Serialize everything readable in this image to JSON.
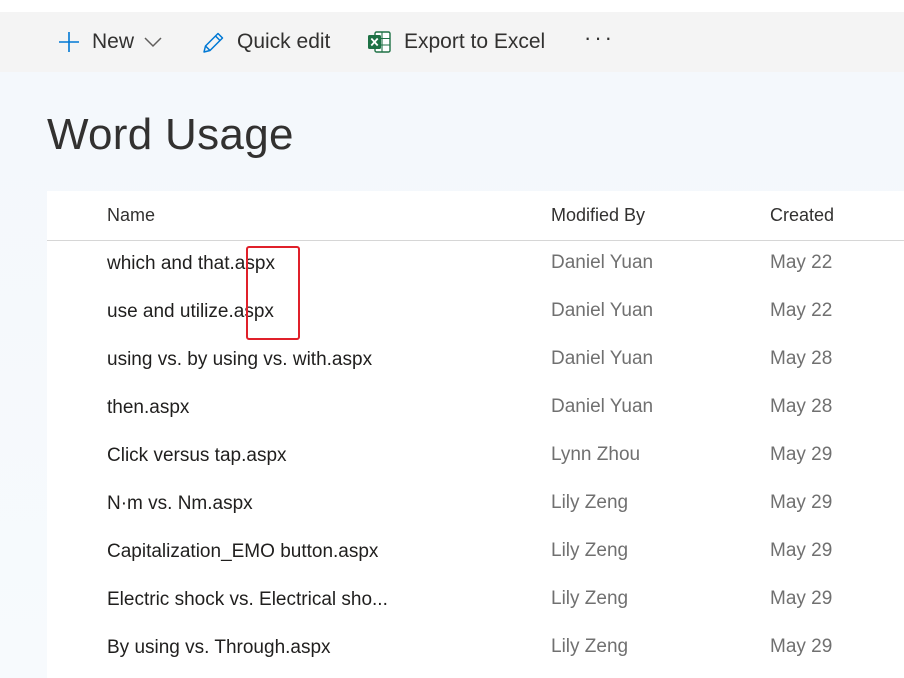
{
  "commandbar": {
    "new_label": "New",
    "quick_edit_label": "Quick edit",
    "export_label": "Export to Excel",
    "more_label": "···"
  },
  "page": {
    "title": "Word Usage"
  },
  "list": {
    "columns": {
      "name": "Name",
      "modified_by": "Modified By",
      "created": "Created"
    },
    "rows": [
      {
        "name": "which and that.aspx",
        "modified_by": "Daniel Yuan",
        "created": "May 22"
      },
      {
        "name": "use and utilize.aspx",
        "modified_by": "Daniel Yuan",
        "created": "May 22"
      },
      {
        "name": "using vs. by using vs. with.aspx",
        "modified_by": "Daniel Yuan",
        "created": "May 28"
      },
      {
        "name": "then.aspx",
        "modified_by": "Daniel Yuan",
        "created": "May 28"
      },
      {
        "name": "Click versus tap.aspx",
        "modified_by": "Lynn Zhou",
        "created": "May 29"
      },
      {
        "name": "N·m vs. Nm.aspx",
        "modified_by": "Lily Zeng",
        "created": "May 29"
      },
      {
        "name": "Capitalization_EMO button.aspx",
        "modified_by": "Lily Zeng",
        "created": "May 29"
      },
      {
        "name": "Electric shock vs. Electrical sho...",
        "modified_by": "Lily Zeng",
        "created": "May 29"
      },
      {
        "name": "By using vs. Through.aspx",
        "modified_by": "Lily Zeng",
        "created": "May 29"
      }
    ]
  },
  "colors": {
    "accent": "#0078d4",
    "excel_green": "#1e7145",
    "highlight": "#e0202a"
  },
  "icons": {
    "new": "plus-icon",
    "chevron": "chevron-down-icon",
    "quick_edit": "pencil-icon",
    "export": "excel-icon"
  }
}
